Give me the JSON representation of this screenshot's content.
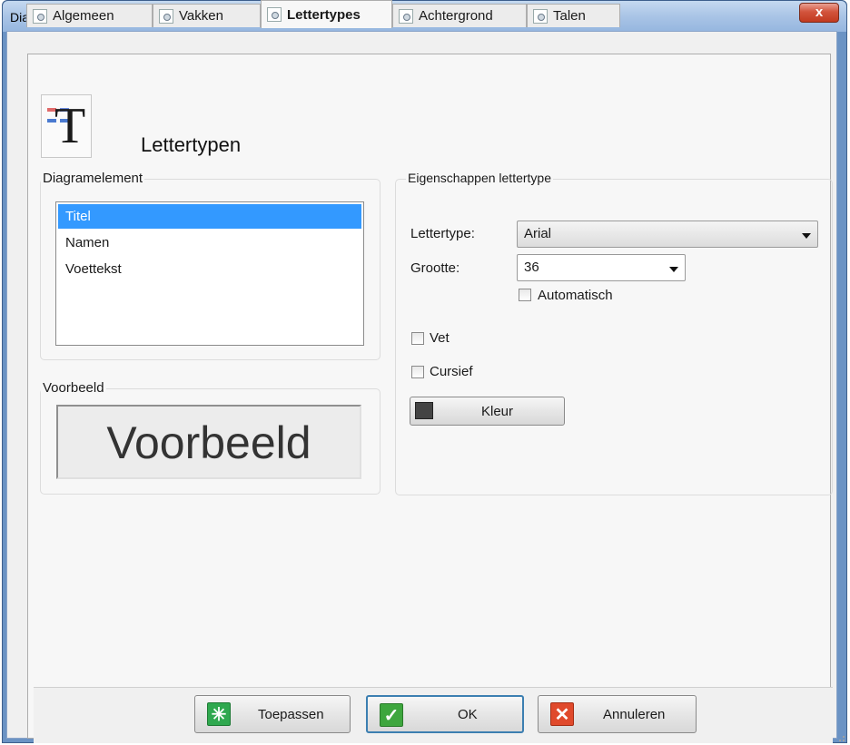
{
  "window": {
    "title": "Diagramopties",
    "close_glyph": "x"
  },
  "tabs": [
    {
      "label": "Algemeen",
      "icon": "settings-icon",
      "active": false
    },
    {
      "label": "Vakken",
      "icon": "settings-icon",
      "active": false
    },
    {
      "label": "Lettertypes",
      "icon": "settings-icon",
      "active": true
    },
    {
      "label": "Achtergrond",
      "icon": "settings-icon",
      "active": false
    },
    {
      "label": "Talen",
      "icon": "settings-icon",
      "active": false
    }
  ],
  "page": {
    "heading": "Lettertypen",
    "heading_icon": "font-type-icon",
    "diagramelement": {
      "legend": "Diagramelement",
      "items": [
        "Titel",
        "Namen",
        "Voettekst"
      ],
      "selected": "Titel"
    },
    "voorbeeld": {
      "legend": "Voorbeeld",
      "sample_text": "Voorbeeld"
    },
    "eigenschappen": {
      "legend": "Eigenschappen lettertype",
      "font_label": "Lettertype:",
      "font_value": "Arial",
      "size_label": "Grootte:",
      "size_value": "36",
      "automatisch_label": "Automatisch",
      "automatisch_checked": false,
      "bold_label": "Vet",
      "bold_checked": false,
      "italic_label": "Cursief",
      "italic_checked": false,
      "color_button_label": "Kleur",
      "color_swatch": "#444444"
    }
  },
  "buttons": {
    "apply_label": "Toepassen",
    "ok_label": "OK",
    "cancel_label": "Annuleren"
  },
  "colors": {
    "selection": "#3399ff",
    "titlebar": "#a9c4e6",
    "close_button": "#c23a1f",
    "apply_icon": "#2fa84f",
    "ok_icon": "#3ea63e",
    "cancel_icon": "#e04a2c"
  }
}
